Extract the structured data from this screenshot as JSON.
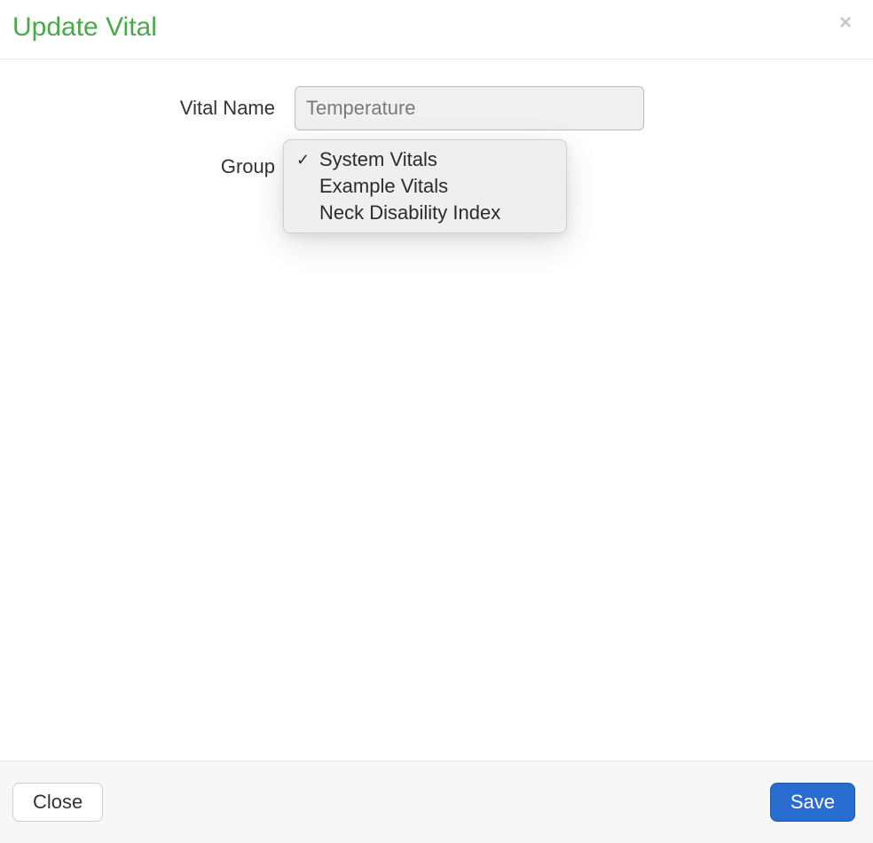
{
  "header": {
    "title": "Update Vital",
    "close_glyph": "×"
  },
  "form": {
    "vital_name_label": "Vital Name",
    "vital_name_value": "Temperature",
    "group_label": "Group"
  },
  "dropdown": {
    "selected_index": 0,
    "items": [
      {
        "label": "System Vitals"
      },
      {
        "label": "Example Vitals"
      },
      {
        "label": "Neck Disability Index"
      }
    ]
  },
  "footer": {
    "close_label": "Close",
    "save_label": "Save"
  }
}
